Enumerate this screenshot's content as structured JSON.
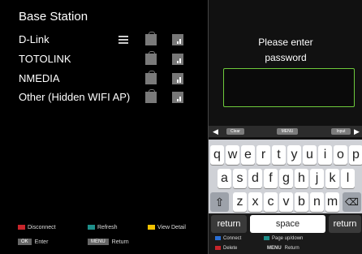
{
  "left": {
    "title": "Base Station",
    "stations": [
      "D-Link",
      "TOTOLINK",
      "NMEDIA",
      "Other (Hidden WIFI AP)"
    ],
    "legend": {
      "disconnect": "Disconnect",
      "refresh": "Refresh",
      "view_detail": "View Detail",
      "ok_key": "OK",
      "enter": "Enter",
      "menu_key": "MENU",
      "return": "Return"
    }
  },
  "dialog": {
    "prompt_line1": "Please enter",
    "prompt_line2": "password",
    "password_value": "",
    "toolbar": {
      "clear": "Clear",
      "menu": "MENU",
      "input": "Input"
    }
  },
  "keyboard": {
    "row1": [
      "q",
      "w",
      "e",
      "r",
      "t",
      "y",
      "u",
      "i",
      "o",
      "p"
    ],
    "row2": [
      "a",
      "s",
      "d",
      "f",
      "g",
      "h",
      "j",
      "k",
      "l"
    ],
    "row3": [
      "z",
      "x",
      "c",
      "v",
      "b",
      "n",
      "m"
    ],
    "return_left": "return",
    "space": "space",
    "return_right": "return"
  },
  "footer": {
    "connect": "Connect",
    "page": "Page up/down",
    "delete": "Delete",
    "menu_key": "MENU",
    "return": "Return"
  },
  "colors": {
    "red": "#c8252b",
    "teal": "#1e8f8a",
    "yellow": "#f2c200",
    "blue": "#2a6fd6",
    "green_border": "#6eca3c"
  }
}
